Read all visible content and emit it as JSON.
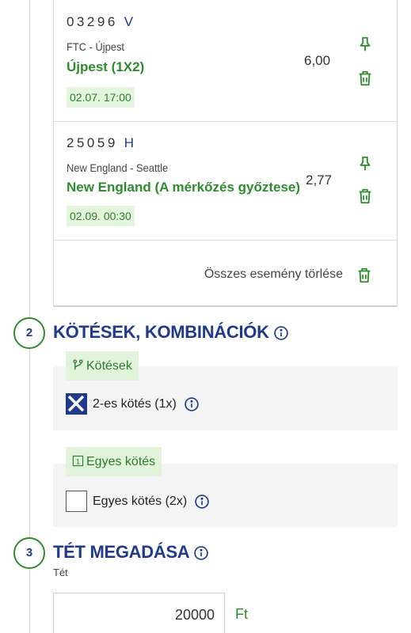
{
  "bets": [
    {
      "code": "03296",
      "mark": "V",
      "teams": "FTC - Újpest",
      "pick": "Újpest (1X2)",
      "date": "02.07. 17:00",
      "odds": "6,00"
    },
    {
      "code": "25059",
      "mark": "H",
      "teams": "New England - Seattle",
      "pick": "New England (A mérkőzés győztese)",
      "date": "02.09. 00:30",
      "odds": "2,77"
    }
  ],
  "clear_all_label": "Összes esemény törlése",
  "section2": {
    "number": "2",
    "title": "KÖTÉSEK, KOMBINÁCIÓK",
    "combos_tag": "Kötések",
    "combo_option": {
      "label": "2-es kötés (1x)",
      "checked": true
    },
    "singles_tag": "Egyes kötés",
    "singles_tag_icon_text": "1",
    "singles_option": {
      "label": "Egyes kötés (2x)",
      "checked": false
    }
  },
  "section3": {
    "number": "3",
    "title": "TÉT MEGADÁSA",
    "stake_label": "Tét",
    "stake_value": "20000",
    "currency": "Ft"
  },
  "colors": {
    "navy": "#1f3a8a",
    "green": "#2e8b2e",
    "tag_bg": "#e2f3db"
  }
}
